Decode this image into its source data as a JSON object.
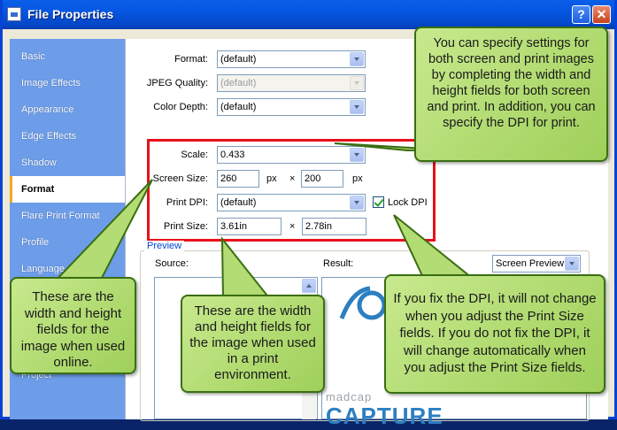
{
  "window": {
    "title": "File Properties",
    "help_label": "?",
    "close_label": "✕"
  },
  "sidebar": {
    "items": [
      {
        "label": "Basic"
      },
      {
        "label": "Image Effects"
      },
      {
        "label": "Appearance"
      },
      {
        "label": "Edge Effects"
      },
      {
        "label": "Shadow"
      },
      {
        "label": "Format"
      },
      {
        "label": "Flare Print Format"
      },
      {
        "label": "Profile"
      },
      {
        "label": "Language"
      },
      {
        "label": "Project"
      }
    ],
    "selected": "Format"
  },
  "form": {
    "format_label": "Format:",
    "format_value": "(default)",
    "jpeg_label": "JPEG Quality:",
    "jpeg_value": "(default)",
    "color_label": "Color Depth:",
    "color_value": "(default)",
    "scale_label": "Scale:",
    "scale_value": "0.433",
    "screen_label": "Screen Size:",
    "screen_w": "260",
    "screen_h": "200",
    "px1": "px",
    "px2": "px",
    "times1": "×",
    "dpi_label": "Print DPI:",
    "dpi_value": "(default)",
    "lock_label": "Lock DPI",
    "print_label": "Print Size:",
    "print_w": "3.61in",
    "print_h": "2.78in",
    "times2": "×"
  },
  "preview": {
    "group_label": "Preview",
    "source_label": "Source:",
    "result_label": "Result:",
    "result_mode": "Screen Preview",
    "logo_small": "madcap",
    "logo_large": "CAPTURE"
  },
  "callouts": {
    "top_right": "You can specify settings for both screen and print images by completing the width and height fields for both screen and print. In addition, you can specify the DPI for print.",
    "left": "These are the width and height fields for the image when used online.",
    "middle": "These are the width and height fields for the image when used in a print environment.",
    "right": "If you fix the DPI, it will not change when you adjust the Print Size fields. If you do not fix the DPI, it will change automatically when you adjust the Print Size fields."
  },
  "colors": {
    "callout_fill": "#a9d867",
    "highlight": "#e8101a",
    "sidebar": "#6d9de8",
    "titlebar": "#0656e0"
  }
}
